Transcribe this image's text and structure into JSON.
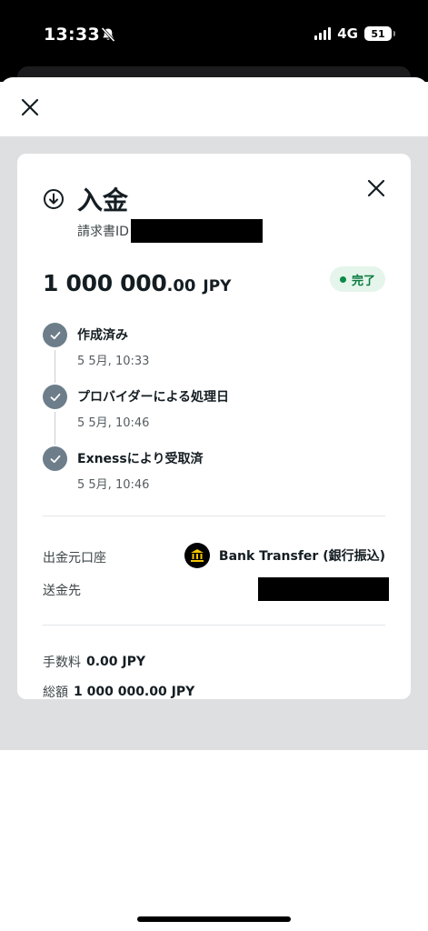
{
  "status_bar": {
    "time": "13:33",
    "network": "4G",
    "battery": "51",
    "icons": [
      "bell-slash-icon",
      "signal-icon",
      "battery-icon"
    ]
  },
  "sheet": {
    "close_icon": "close-icon"
  },
  "card": {
    "title": "入金",
    "title_icon": "download-circle-icon",
    "invoice_label": "請求書ID",
    "amount_integer": "1 000 000",
    "amount_decimal": ".00",
    "currency": "JPY",
    "status": "完了",
    "status_color": "#0a8a47",
    "timeline": [
      {
        "title": "作成済み",
        "time": "5 5月, 10:33"
      },
      {
        "title": "プロバイダーによる処理日",
        "time": "5 5月, 10:46"
      },
      {
        "title": "Exnessにより受取済",
        "time": "5 5月, 10:46"
      }
    ],
    "details": {
      "source_label": "出金元口座",
      "source_value": "Bank Transfer (銀行振込)",
      "source_icon": "bank-icon",
      "destination_label": "送金先"
    },
    "fee_label": "手数料",
    "fee_value": "0.00 JPY",
    "total_label": "総額",
    "total_value": "1 000 000.00 JPY"
  },
  "colors": {
    "check_circle": "#6d7e8a",
    "overlay": "#dedfe0",
    "text_primary": "#141d22"
  }
}
